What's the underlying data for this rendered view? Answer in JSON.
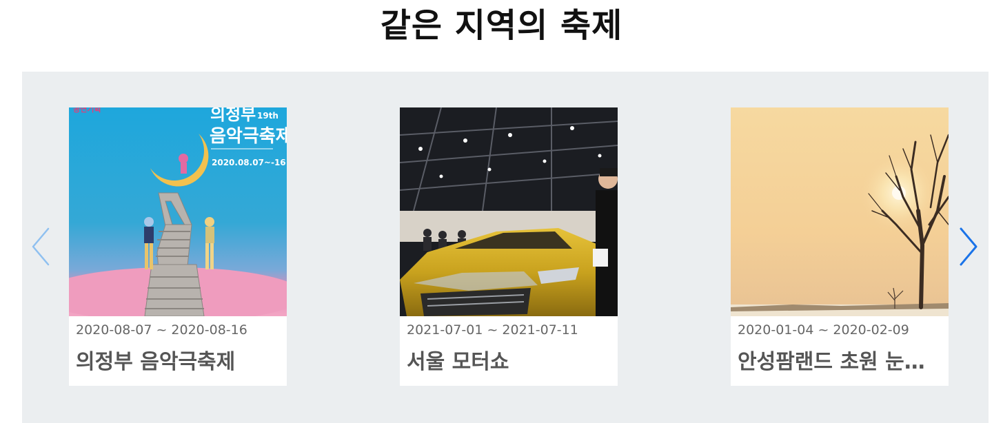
{
  "section": {
    "title": "같은 지역의 축제"
  },
  "carousel": {
    "prev_label": "이전",
    "next_label": "다음",
    "colors": {
      "background": "#ebeef0",
      "prev_arrow": "#8fc0f0",
      "next_arrow": "#1a73e8"
    },
    "cards": [
      {
        "date_range": "2020-08-07 ~ 2020-08-16",
        "name": "의정부 음악극축제",
        "image": "festival-poster"
      },
      {
        "date_range": "2021-07-01 ~ 2021-07-11",
        "name": "서울 모터쇼",
        "image": "motor-show-photo"
      },
      {
        "date_range": "2020-01-04 ~ 2020-02-09",
        "name": "안성팜랜드 초원 눈썰매장",
        "image": "winter-field-photo"
      }
    ],
    "poster": {
      "title_line1": "의정부",
      "edition": "19th",
      "title_line2": "음악극축제",
      "dates": "2020.08.07~-16"
    }
  }
}
